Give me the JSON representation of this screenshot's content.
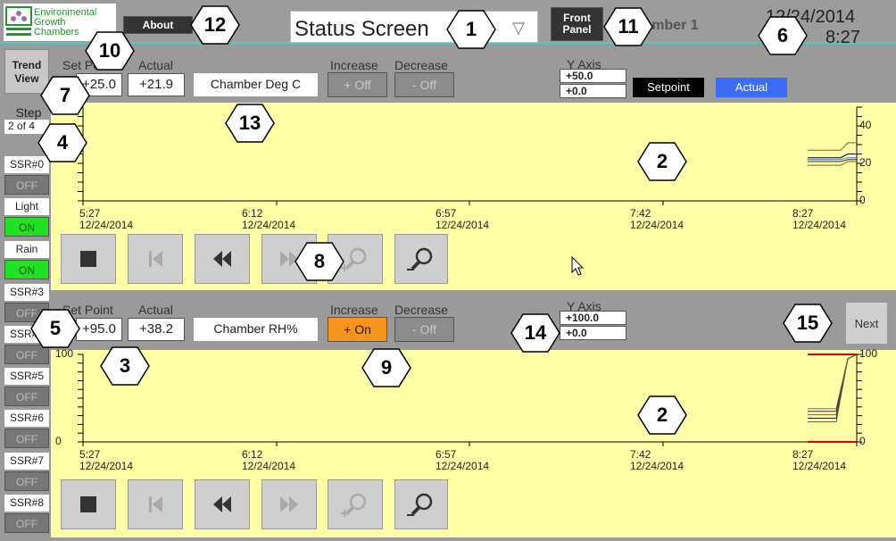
{
  "header": {
    "logo_lines": [
      "Environmental",
      "Growth",
      "Chambers"
    ],
    "about_label": "About",
    "screen_select": "Status Screen",
    "front_panel_label": [
      "Front",
      "Panel"
    ],
    "chamber_name": "Chamber 1",
    "date": "12/24/2014",
    "time": "8:27"
  },
  "sidebar": {
    "trend_view_label": [
      "Trend",
      "View"
    ],
    "step_label": "Step",
    "step_value": "2 of 4",
    "outputs": [
      {
        "label": "SSR#0",
        "state": "OFF"
      },
      {
        "label": "Light",
        "state": "ON"
      },
      {
        "label": "Rain",
        "state": "ON"
      },
      {
        "label": "SSR#3",
        "state": "OFF"
      },
      {
        "label": "SSR#4",
        "state": "OFF"
      },
      {
        "label": "SSR#5",
        "state": "OFF"
      },
      {
        "label": "SSR#6",
        "state": "OFF"
      },
      {
        "label": "SSR#7",
        "state": "OFF"
      },
      {
        "label": "SSR#8",
        "state": "OFF"
      }
    ]
  },
  "panels": [
    {
      "setpoint_label": "Set Point",
      "actual_label": "Actual",
      "setpoint": "+25.0",
      "actual": "+21.9",
      "channel": "Chamber Deg C",
      "increase_label": "Increase",
      "increase_btn": "+ Off",
      "decrease_label": "Decrease",
      "decrease_btn": "- Off",
      "yaxis_label": "Y Axis",
      "ymax": "+50.0",
      "ymin": "+0.0",
      "legend_setpoint": "Setpoint",
      "legend_actual": "Actual",
      "axis_ticks": [
        "40",
        "20",
        "0"
      ],
      "time_ticks": [
        [
          "5:27",
          "12/24/2014"
        ],
        [
          "6:12",
          "12/24/2014"
        ],
        [
          "6:57",
          "12/24/2014"
        ],
        [
          "7:42",
          "12/24/2014"
        ],
        [
          "8:27",
          "12/24/2014"
        ]
      ]
    },
    {
      "setpoint_label": "Set Point",
      "actual_label": "Actual",
      "setpoint": "+95.0",
      "actual": "+38.2",
      "channel": "Chamber RH%",
      "increase_label": "Increase",
      "increase_btn": "+ On",
      "decrease_label": "Decrease",
      "decrease_btn": "- Off",
      "yaxis_label": "Y Axis",
      "ymax": "+100.0",
      "ymin": "+0.0",
      "axis_ticks": [
        "100",
        "0"
      ],
      "time_ticks": [
        [
          "5:27",
          "12/24/2014"
        ],
        [
          "6:12",
          "12/24/2014"
        ],
        [
          "6:57",
          "12/24/2014"
        ],
        [
          "7:42",
          "12/24/2014"
        ],
        [
          "8:27",
          "12/24/2014"
        ]
      ],
      "next_label": "Next"
    }
  ],
  "colors": {
    "chart_bg": "#ffffa8",
    "setpoint": "#000000",
    "actual": "#3a6cf5",
    "increase_on": "#f7941d",
    "output_on": "#22e022"
  },
  "annotations": [
    "1",
    "12",
    "10",
    "11",
    "6",
    "7",
    "13",
    "4",
    "2",
    "8",
    "5",
    "3",
    "9",
    "14",
    "15",
    "2"
  ]
}
